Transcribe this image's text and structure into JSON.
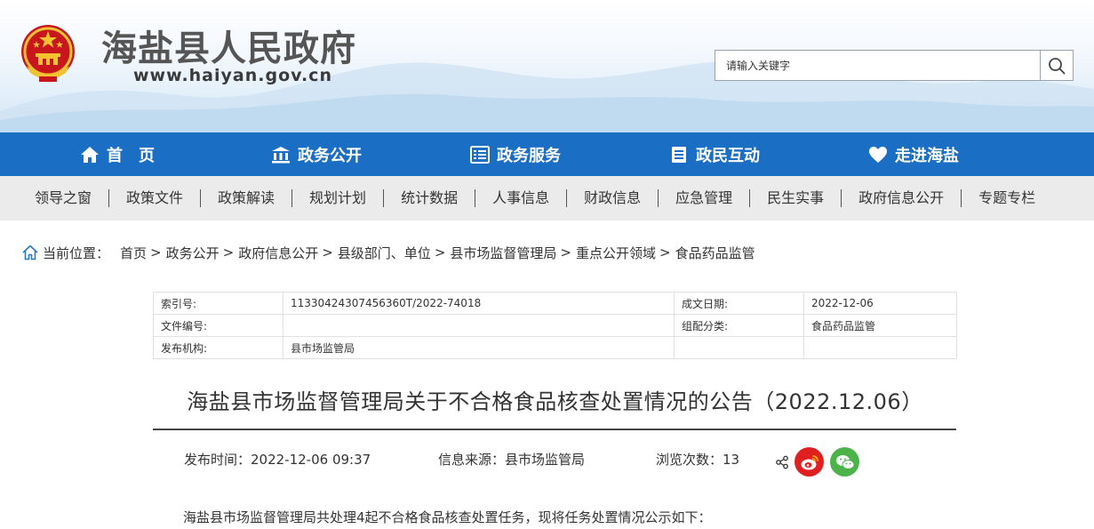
{
  "header": {
    "site_title": "海盐县人民政府",
    "site_url": "www.haiyan.gov.cn",
    "search_placeholder": "请输入关键字",
    "emblem_icon": "national-emblem",
    "search_icon": "magnifier"
  },
  "main_nav": [
    {
      "label": "首　页",
      "icon": "home"
    },
    {
      "label": "政务公开",
      "icon": "building"
    },
    {
      "label": "政务服务",
      "icon": "document-list"
    },
    {
      "label": "政民互动",
      "icon": "list"
    },
    {
      "label": "走进海盐",
      "icon": "heart"
    }
  ],
  "sub_nav": [
    "领导之窗",
    "政策文件",
    "政策解读",
    "规划计划",
    "统计数据",
    "人事信息",
    "财政信息",
    "应急管理",
    "民生实事",
    "政府信息公开",
    "专题专栏"
  ],
  "breadcrumb": {
    "label": "当前位置：",
    "items": [
      "首页",
      "政务公开",
      "政府信息公开",
      "县级部门、单位",
      "县市场监督管理局",
      "重点公开领域",
      "食品药品监管"
    ],
    "separator": ">"
  },
  "meta": {
    "index_key": "索引号:",
    "index_value": "11330424307456360T/2022-74018",
    "date_key": "成文日期:",
    "date_value": "2022-12-06",
    "doc_no_key": "文件编号:",
    "doc_no_value": "",
    "category_key": "组配分类:",
    "category_value": "食品药品监管",
    "org_key": "发布机构:",
    "org_value": "县市场监管局"
  },
  "article": {
    "title": "海盐县市场监督管理局关于不合格食品核查处置情况的公告（2022.12.06）",
    "publish_time": "发布时间：2022-12-06 09:37",
    "source": "信息来源：县市场监管局",
    "views": "浏览次数：13",
    "body_first_line": "海盐县市场监督管理局共处理4起不合格食品核查处置任务，现将任务处置情况公示如下："
  },
  "colors": {
    "nav_blue": "#1a6ec3",
    "subnav_bg": "#ebebeb",
    "weibo_red": "#e02020",
    "wechat_green": "#4cb34a"
  }
}
